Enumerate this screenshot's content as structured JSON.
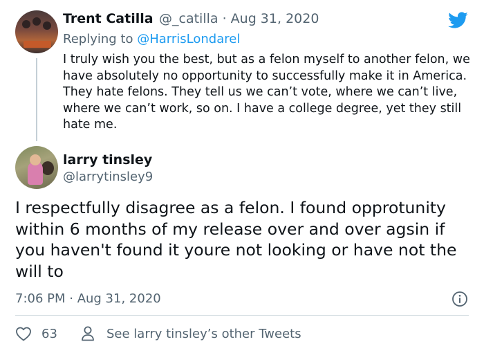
{
  "parent_tweet": {
    "display_name": "Trent Catilla",
    "handle": "@_catilla",
    "separator": "·",
    "date": "Aug 31, 2020",
    "reply_prefix": "Replying to",
    "reply_to": "@HarrisLondarel",
    "text": "I truly wish you the best, but as a felon myself to another felon, we have absolutely no opportunity to successfully make it in America. They hate felons. They tell us we can’t vote, where we can’t live, where we can’t work, so on. I have a college degree, yet they still hate me."
  },
  "main_tweet": {
    "display_name": "larry tinsley",
    "handle": "@larrytinsley9",
    "text": "I respectfully disagree as a felon. I found opprotunity within 6 months of my release over and over agsin if you haven't found it youre not looking or have not the will to",
    "timestamp": "7:06 PM · Aug 31, 2020"
  },
  "actions": {
    "like_count": "63",
    "other_tweets_label": "See larry tinsley’s other Tweets"
  },
  "icons": {
    "brand": "twitter-bird-icon",
    "info": "info-icon",
    "like": "heart-icon",
    "profile": "user-icon"
  },
  "colors": {
    "brand_blue": "#1d9bf0",
    "text_primary": "#0f1419",
    "text_secondary": "#536471",
    "divider": "#cfd9de",
    "thread_line": "#c4cfd6"
  }
}
